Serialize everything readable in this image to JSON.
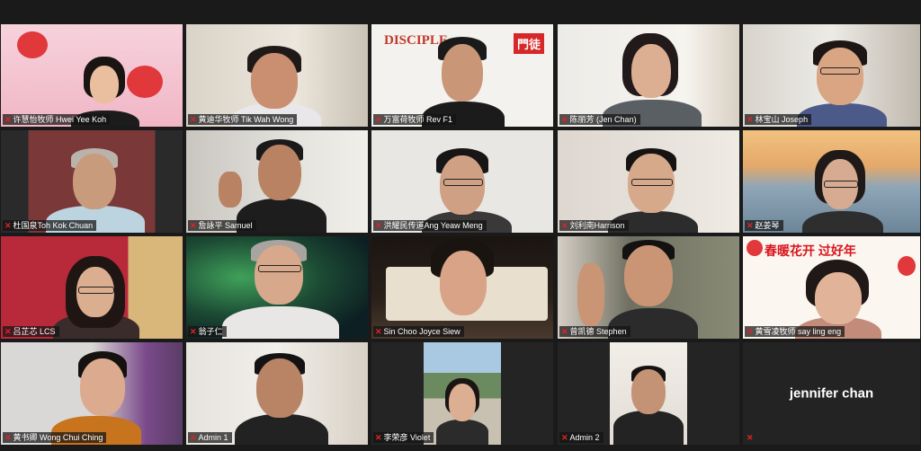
{
  "meeting": {
    "view": "gallery",
    "active_speaker": "万富荷牧师 Rev F1",
    "accent_color": "#f5e642",
    "muted_icon_color": "#e02424"
  },
  "participants": [
    {
      "name": "许慧怡牧师 Hwei Yee Koh",
      "muted": true,
      "video": true
    },
    {
      "name": "黄迪华牧师 Tik Wah Wong",
      "muted": true,
      "video": true
    },
    {
      "name": "万富荷牧师 Rev F1",
      "muted": true,
      "video": true,
      "active": true,
      "logo_left": "DISCIPLE",
      "logo_right": "門徒"
    },
    {
      "name": "陈丽芳 (Jen Chan)",
      "muted": true,
      "video": true
    },
    {
      "name": "林宝山 Joseph",
      "muted": true,
      "video": true
    },
    {
      "name": "杜国泉Toh Kok Chuan",
      "muted": true,
      "video": true
    },
    {
      "name": "詹詠平 Samuel",
      "muted": true,
      "video": true
    },
    {
      "name": "洪耀民传道Ang Yeaw Meng",
      "muted": true,
      "video": true
    },
    {
      "name": "刘利南Harrison",
      "muted": true,
      "video": true
    },
    {
      "name": "赵姜琴",
      "muted": true,
      "video": true
    },
    {
      "name": "吕芷芯 LCS",
      "muted": true,
      "video": true
    },
    {
      "name": "翁子仁",
      "muted": true,
      "video": true
    },
    {
      "name": "Sin Choo Joyce Siew",
      "muted": true,
      "video": true
    },
    {
      "name": "曾凯德 Stephen",
      "muted": true,
      "video": true
    },
    {
      "name": "黄雪凌牧师 say ling eng",
      "muted": true,
      "video": true,
      "banner_text": "春暖花开 过好年"
    },
    {
      "name": "黄书卿 Wong Chui Ching",
      "muted": true,
      "video": true
    },
    {
      "name": "Admin 1",
      "muted": true,
      "video": true
    },
    {
      "name": "李荣彦 Violet",
      "muted": true,
      "video": true
    },
    {
      "name": "Admin 2",
      "muted": true,
      "video": true
    },
    {
      "name": "jennifer chan",
      "muted": true,
      "video": false
    }
  ]
}
